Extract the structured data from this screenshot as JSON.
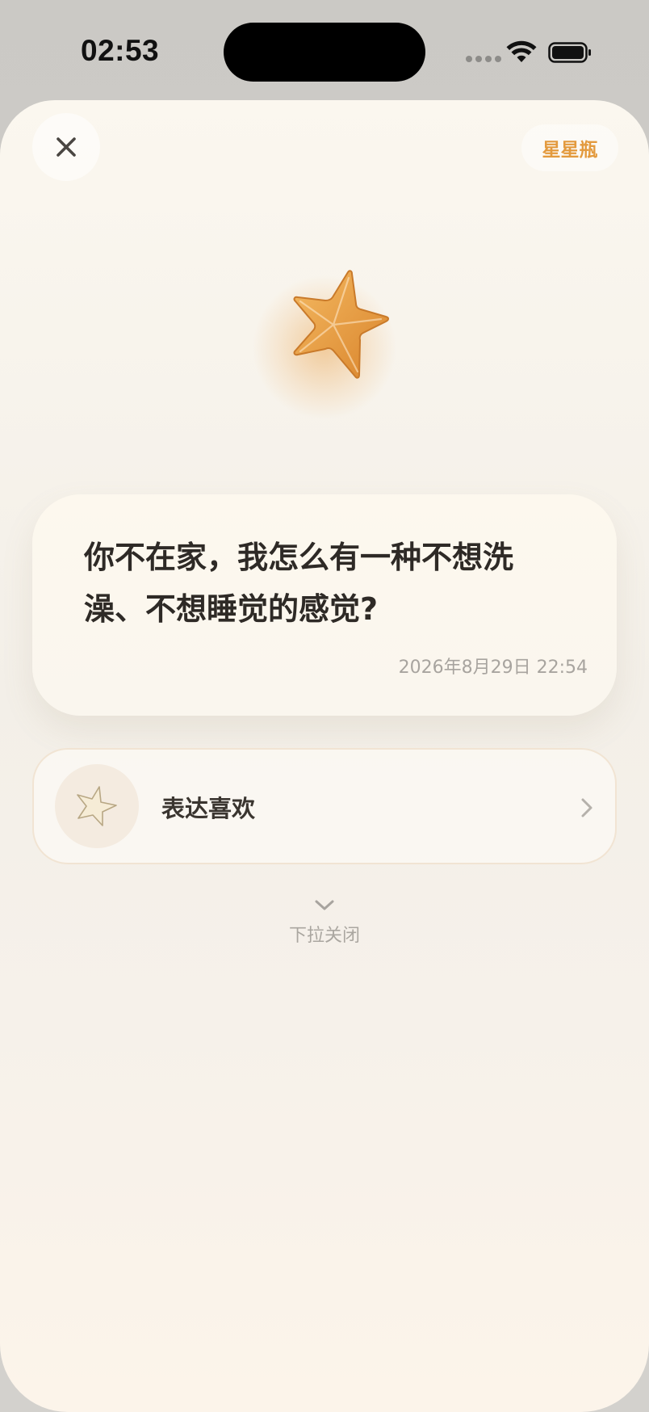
{
  "status_bar": {
    "time": "02:53"
  },
  "header": {
    "close_icon": "close-icon",
    "jar_label": "星星瓶"
  },
  "hero": {
    "icon": "star-icon",
    "color": "#e9a04a"
  },
  "message": {
    "text": "你不在家，我怎么有一种不想洗澡、不想睡觉的感觉?",
    "date": "2026年8月29日 22:54"
  },
  "like_action": {
    "icon": "star-outline-icon",
    "label": "表达喜欢"
  },
  "pull_hint": {
    "label": "下拉关闭"
  },
  "colors": {
    "accent": "#e39a3e",
    "text_primary": "#2e2a26",
    "text_muted": "#a8a49f"
  }
}
